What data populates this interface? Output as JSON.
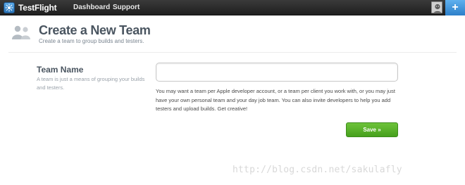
{
  "topbar": {
    "brand": "TestFlight",
    "nav": [
      {
        "label": "Dashboard"
      },
      {
        "label": "Support"
      }
    ],
    "add_label": "+"
  },
  "header": {
    "title": "Create a New Team",
    "subtitle": "Create a team to group builds and testers."
  },
  "form": {
    "field_label": "Team Name",
    "field_description": "A team is just a means of grouping your builds and testers.",
    "input_value": "",
    "help_text": "You may want a team per Apple developer account, or a team per client you work with, or you may just have your own personal team and your day job team. You can also invite developers to help you add testers and upload builds. Get creative!",
    "save_label": "Save »"
  },
  "watermark": "http://blog.csdn.net/sakulafly",
  "colors": {
    "topbar": "#2a2a2a",
    "accent": "#3a8ad6",
    "save_button": "#55ab27",
    "title": "#4a5560"
  },
  "icons": {
    "brand": "testflight-logo-icon",
    "header": "users-icon",
    "avatar": "user-avatar-icon",
    "add": "plus-icon"
  }
}
